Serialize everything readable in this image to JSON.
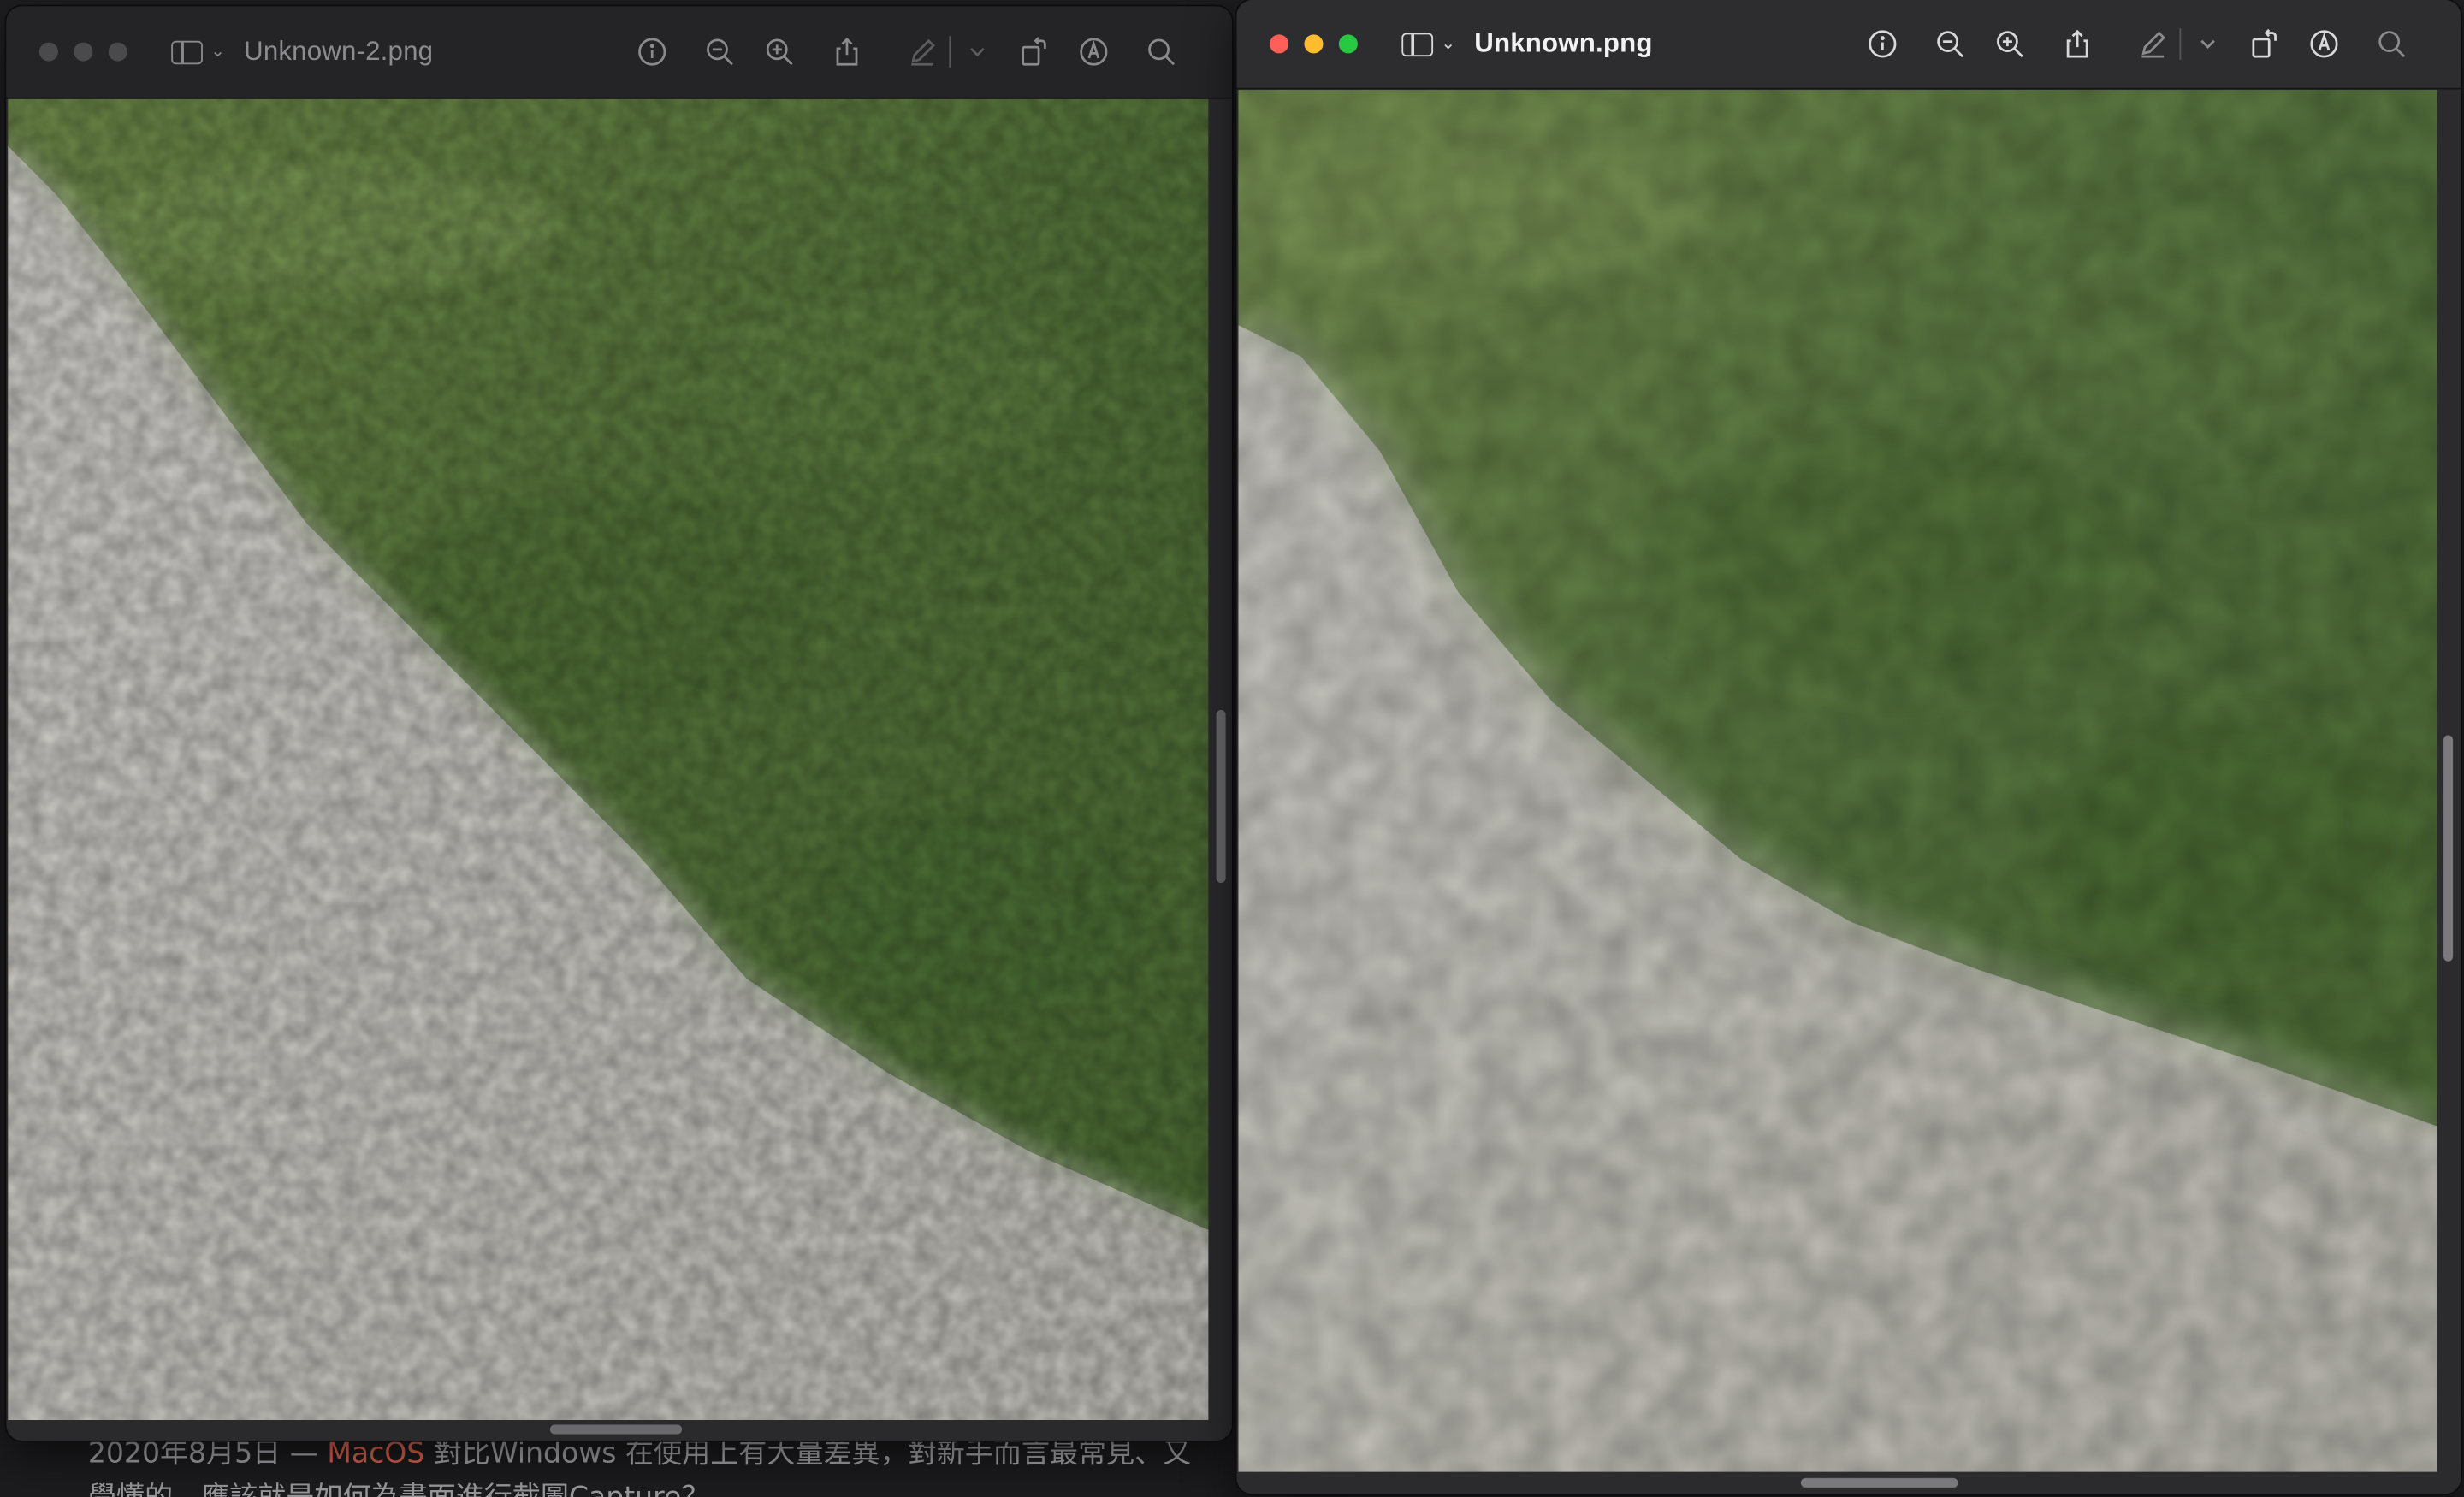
{
  "background_page": {
    "line1_prefix": "2020年8月5日 — ",
    "line1_link": "MacOS",
    "line1_suffix": " 對比Windows 在使用上有大量差異，對新手而言最常見、又",
    "line2": "學懂的，應該就是如何為畫面進行截圖Capture？"
  },
  "windows": [
    {
      "title": "Unknown-2.png",
      "active": false
    },
    {
      "title": "Unknown.png",
      "active": true
    }
  ],
  "icons": [
    "sidebar-icon",
    "chevron-down-icon",
    "info-icon",
    "zoom-out-icon",
    "zoom-in-icon",
    "share-icon",
    "markup-pen-icon",
    "rotate-icon",
    "annotate-icon",
    "search-icon"
  ],
  "colors": {
    "close": "#fe5f57",
    "minimize": "#febc2e",
    "zoom": "#28c840",
    "accent_link": "#e8664f"
  }
}
